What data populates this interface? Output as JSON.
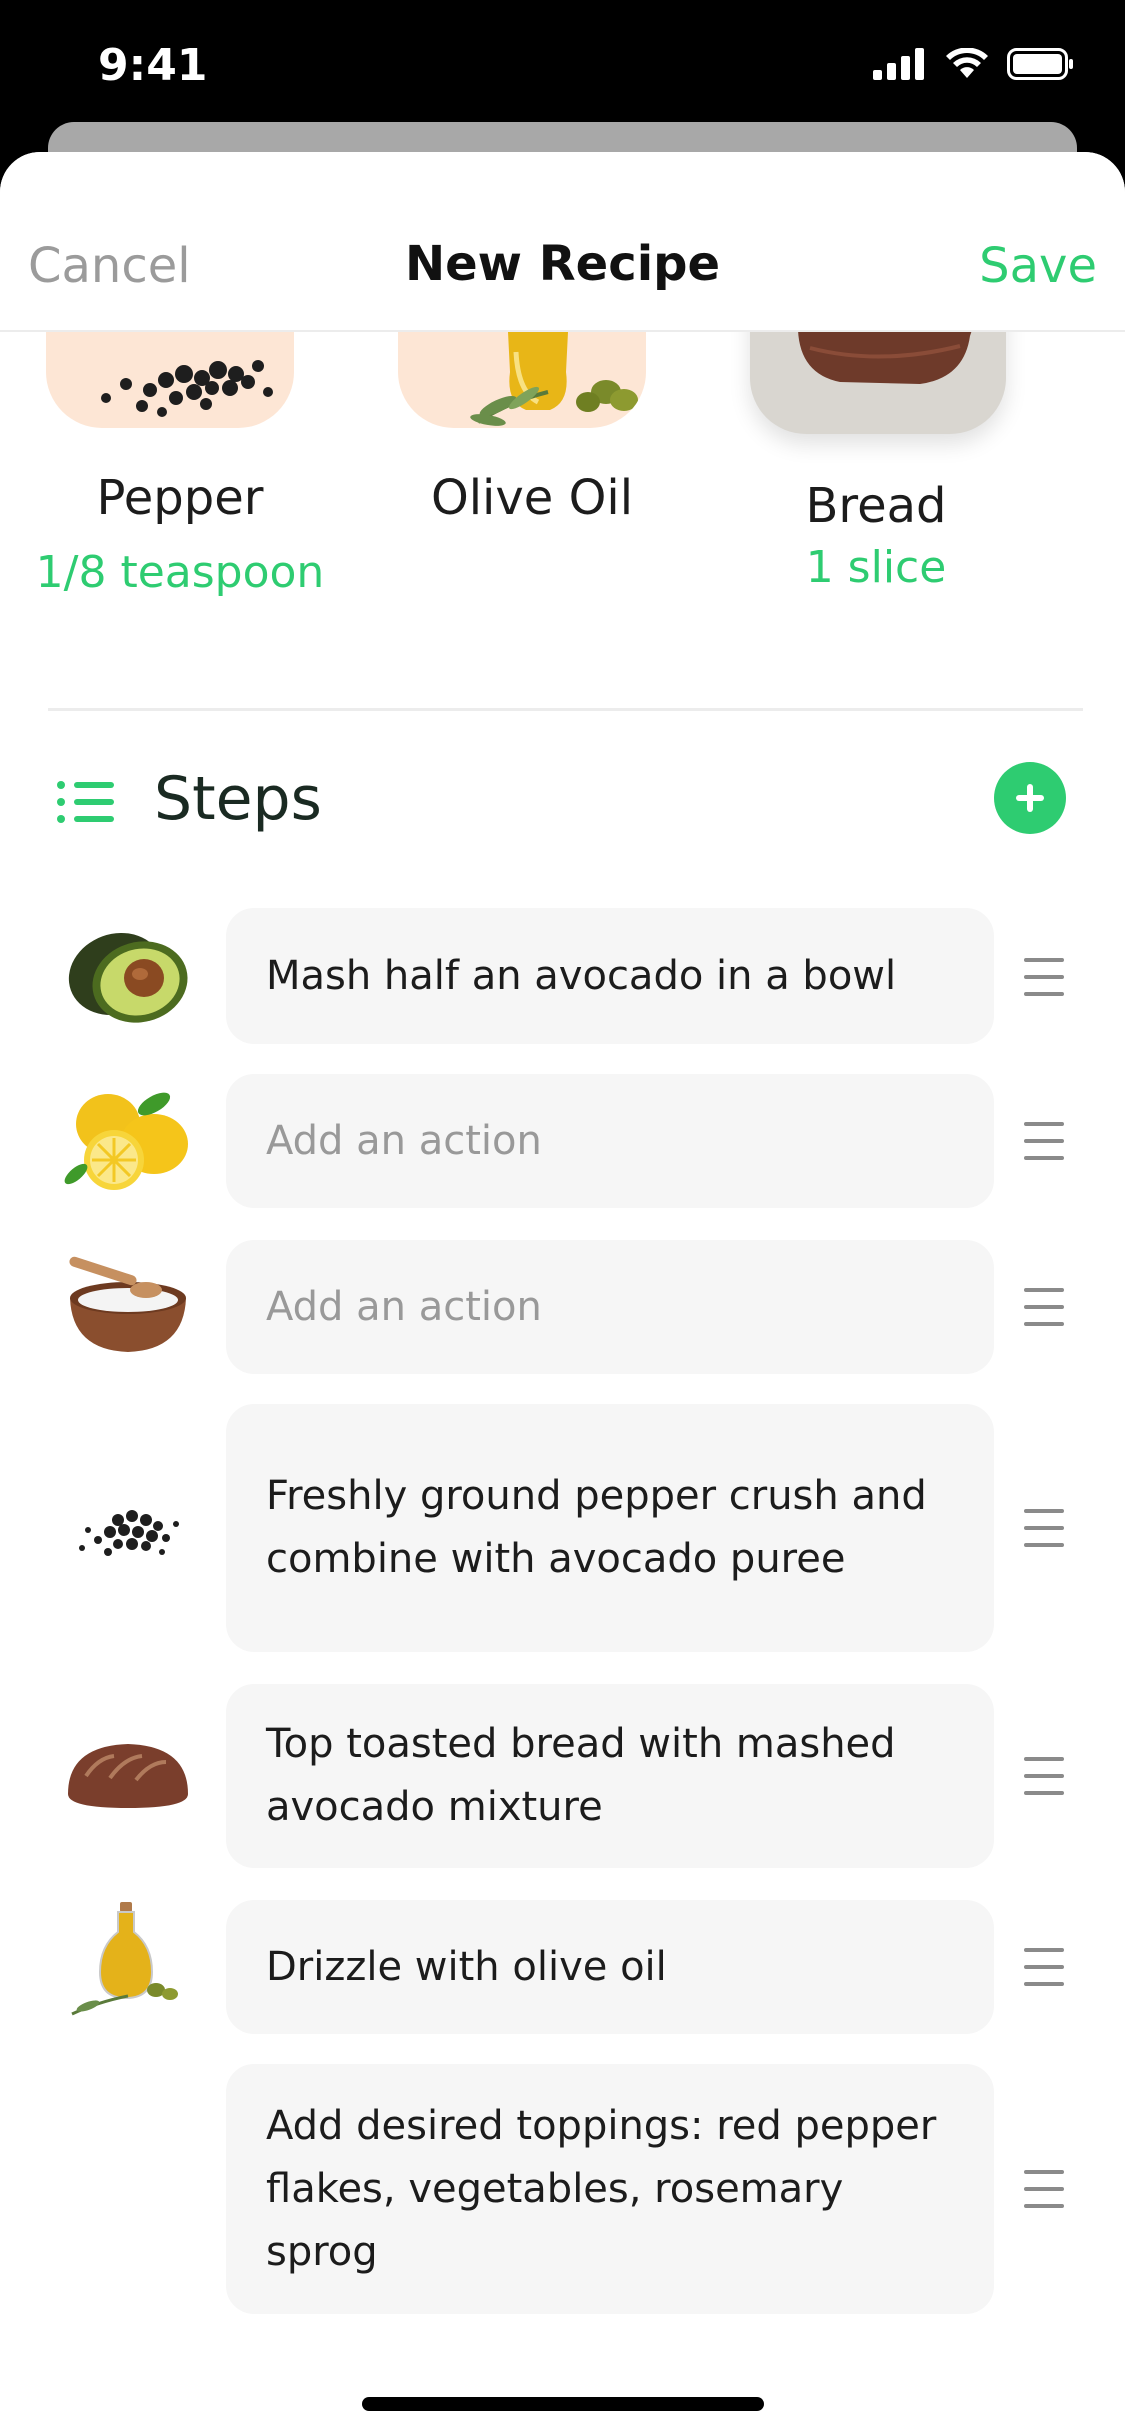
{
  "status_bar": {
    "time": "9:41"
  },
  "nav": {
    "cancel": "Cancel",
    "title": "New Recipe",
    "save": "Save"
  },
  "ingredients": [
    {
      "name": "Pepper",
      "quantity": "1/8 teaspoon",
      "icon": "pepper-icon"
    },
    {
      "name": "Olive Oil",
      "quantity": "",
      "icon": "olive-oil-icon"
    },
    {
      "name": "Bread",
      "quantity": "1 slice",
      "icon": "bread-icon"
    }
  ],
  "steps_section": {
    "title": "Steps"
  },
  "steps": [
    {
      "text": "Mash half an avocado in a bowl",
      "placeholder": false,
      "icon": "avocado-icon"
    },
    {
      "text": "Add an action",
      "placeholder": true,
      "icon": "lemon-icon"
    },
    {
      "text": "Add an action",
      "placeholder": true,
      "icon": "salt-bowl-icon"
    },
    {
      "text": "Freshly ground pepper crush and combine with avocado puree",
      "placeholder": false,
      "icon": "pepper-icon"
    },
    {
      "text": "Top toasted bread with mashed avocado mixture",
      "placeholder": false,
      "icon": "bread-icon"
    },
    {
      "text": "Drizzle with olive oil",
      "placeholder": false,
      "icon": "olive-oil-icon"
    },
    {
      "text": "Add desired toppings: red pepper flakes, vegetables, rosemary sprog",
      "placeholder": false,
      "icon": ""
    }
  ],
  "colors": {
    "accent": "#2ecc71",
    "card_bg": "#f6f6f6",
    "peach": "#fde6d5",
    "stone": "#d9d6d0"
  }
}
